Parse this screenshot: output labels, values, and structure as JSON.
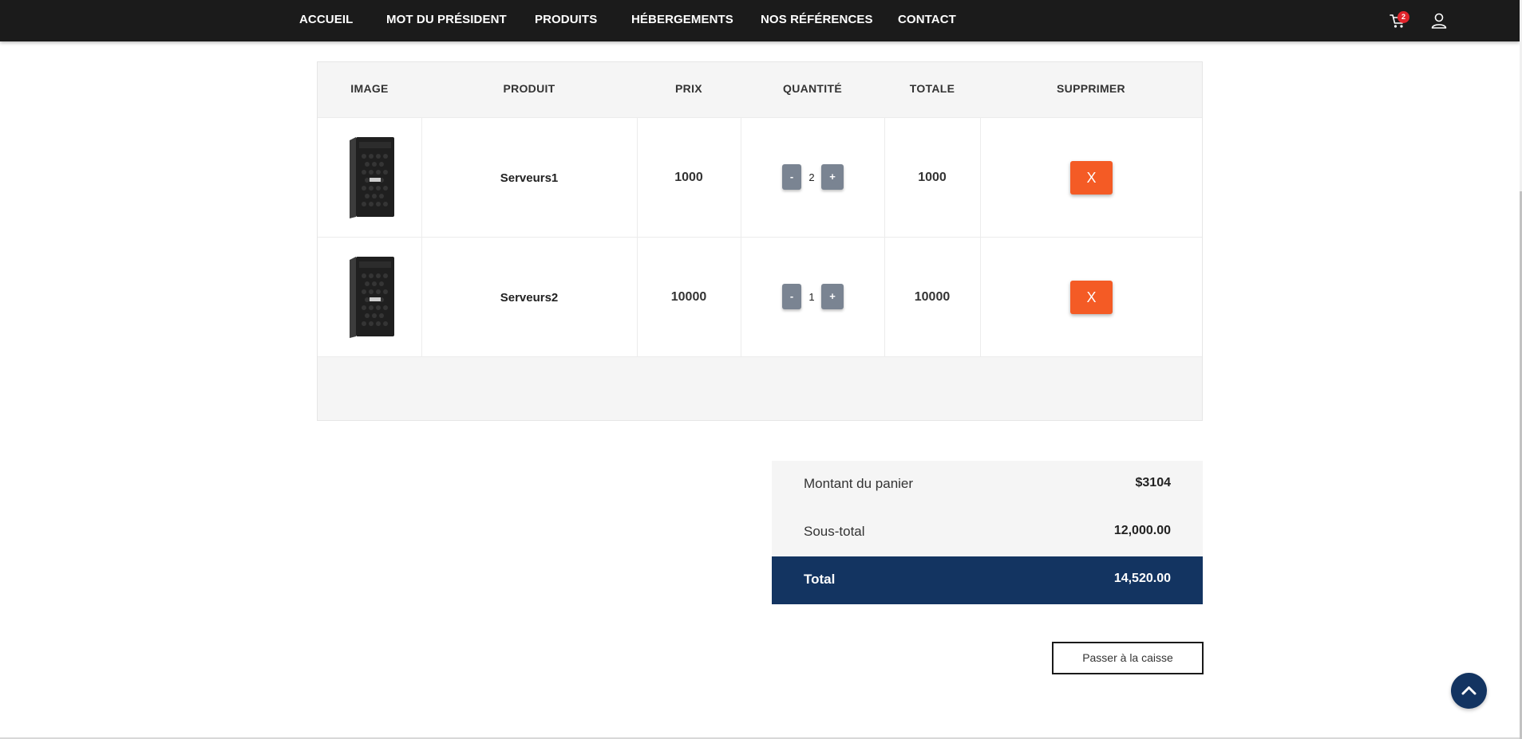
{
  "nav": {
    "items": [
      "ACCUEIL",
      "MOT DU PRÉSIDENT",
      "PRODUITS",
      "HÉBERGEMENTS",
      "NOS RÉFÉRENCES",
      "CONTACT"
    ],
    "cart_count": "2",
    "icons": [
      "cart-icon",
      "user-icon"
    ]
  },
  "table": {
    "headers": [
      "IMAGE",
      "PRODUIT",
      "PRIX",
      "QUANTITÉ",
      "TOTALE",
      "SUPPRIMER"
    ],
    "rows": [
      {
        "image": "server-tower",
        "product": "Serveurs1",
        "price": "1000",
        "minus": "-",
        "quantity": "2",
        "plus": "+",
        "total": "1000",
        "delete": "X"
      },
      {
        "image": "server-tower",
        "product": "Serveurs2",
        "price": "10000",
        "minus": "-",
        "quantity": "1",
        "plus": "+",
        "total": "10000",
        "delete": "X"
      }
    ]
  },
  "summary": {
    "cart_amount_label": "Montant du panier",
    "cart_amount_value": "$3104",
    "subtotal_label": "Sous-total",
    "subtotal_value": "12,000.00",
    "total_label": "Total",
    "total_value": "14,520.00"
  },
  "checkout_label": "Passer à la caisse",
  "colors": {
    "nav_bg": "#1b1b1b",
    "accent_delete": "#f45b25",
    "total_bg": "#133461",
    "qty_button": "#7a8492",
    "badge": "#e0242b"
  }
}
